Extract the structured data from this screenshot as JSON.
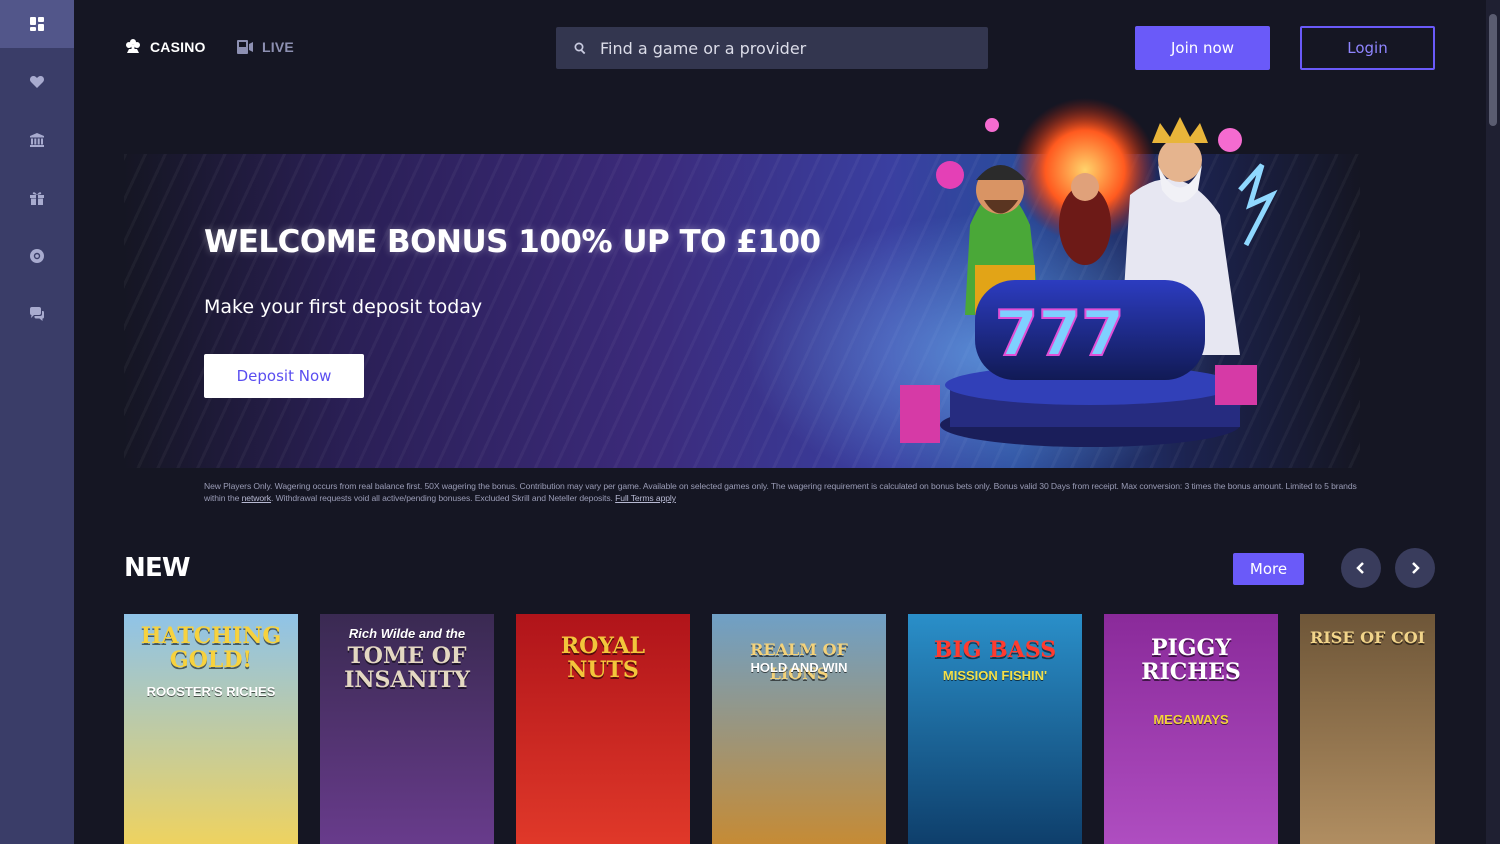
{
  "sidebar": {
    "items": [
      {
        "icon": "grid-icon"
      },
      {
        "icon": "heart-icon"
      },
      {
        "icon": "bank-icon"
      },
      {
        "icon": "gift-icon"
      },
      {
        "icon": "lifebuoy-icon"
      },
      {
        "icon": "chat-icon"
      }
    ]
  },
  "header": {
    "tabs": [
      {
        "label": "CASINO",
        "icon": "cards-icon"
      },
      {
        "label": "LIVE",
        "icon": "live-icon"
      }
    ],
    "search_placeholder": "Find a game or a provider",
    "join_label": "Join now",
    "login_label": "Login"
  },
  "banner": {
    "title": "WELCOME BONUS 100% UP TO £100",
    "subtitle": "Make your first deposit today",
    "cta": "Deposit Now",
    "terms_text_1": "New Players Only. Wagering occurs from real balance first. 50X wagering the bonus. Contribution may vary per game. Available on selected games only. The wagering requirement is calculated on bonus bets only. Bonus valid 30 Days from receipt. Max conversion: 3 times the bonus amount. Limited to 5 brands within the",
    "terms_link_network": "network",
    "terms_text_2": ". Withdrawal requests void all active/pending bonuses. Excluded Skrill and Neteller deposits.",
    "terms_link_full": "Full Terms apply"
  },
  "new_section": {
    "title": "NEW",
    "more_label": "More",
    "games": [
      {
        "title": "HATCHING GOLD!",
        "subtitle": "ROOSTER'S RICHES",
        "bg": "#8fc3e8",
        "bg2": "#f2d35a",
        "title_color": "#f7d23e"
      },
      {
        "title": "TOME OF INSANITY",
        "subtitle": "Rich Wilde and the",
        "bg": "#3a2a52",
        "bg2": "#6a3c8e",
        "title_color": "#e4d8c2"
      },
      {
        "title": "ROYAL NUTS",
        "subtitle": "",
        "bg": "#b0141a",
        "bg2": "#e23a2a",
        "title_color": "#f3c53b"
      },
      {
        "title": "REALM OF LIONS",
        "subtitle": "HOLD AND WIN",
        "bg": "#6fa0c6",
        "bg2": "#c98a2f",
        "title_color": "#f4d27a"
      },
      {
        "title": "BIG BASS",
        "subtitle": "MISSION FISHIN'",
        "bg": "#2a8fc9",
        "bg2": "#0d3b67",
        "title_color": "#ff3b2f"
      },
      {
        "title": "PIGGY RICHES",
        "subtitle": "MEGAWAYS",
        "bg": "#8a2a9a",
        "bg2": "#b04fc2",
        "title_color": "#ffffff"
      },
      {
        "title": "RISE OF COI",
        "subtitle": "",
        "bg": "#6e5638",
        "bg2": "#b39063",
        "title_color": "#f1d48a"
      }
    ]
  }
}
